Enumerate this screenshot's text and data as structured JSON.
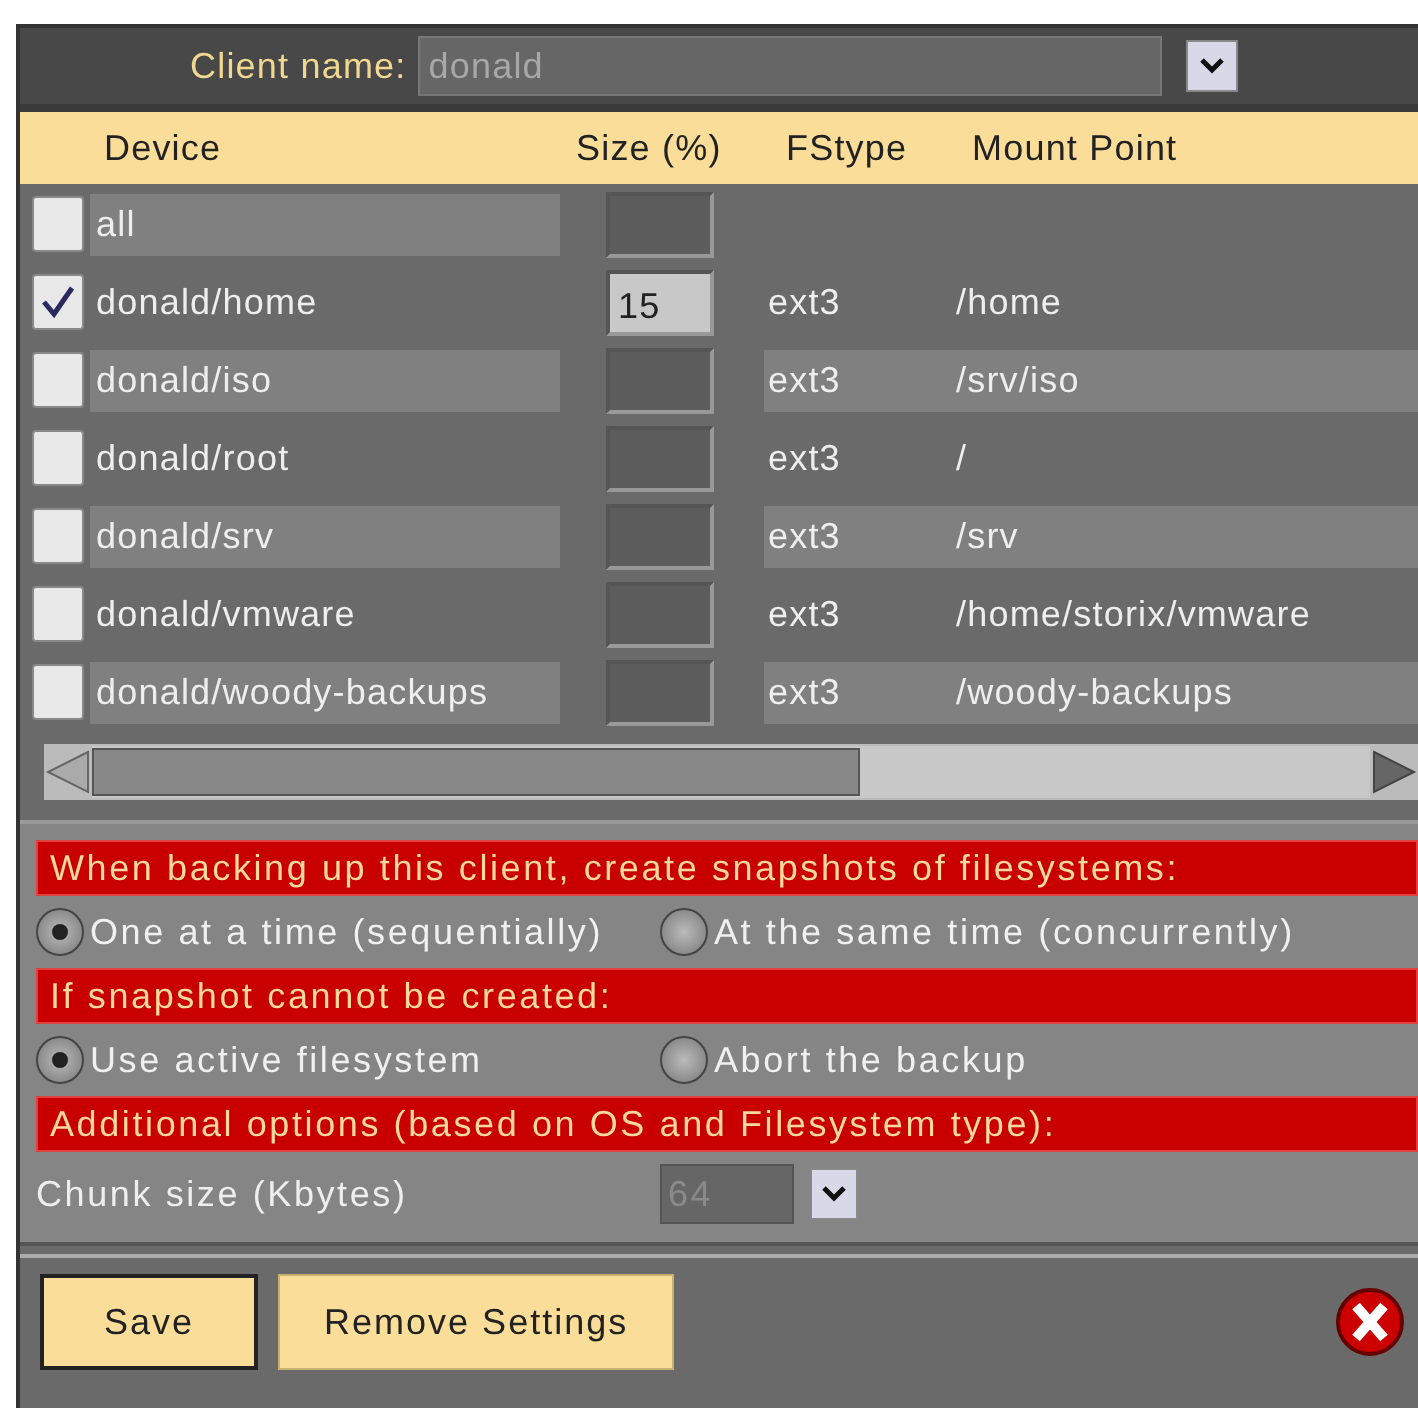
{
  "client": {
    "label": "Client name:",
    "value": "donald"
  },
  "table": {
    "columns": [
      "Device",
      "Size (%)",
      "FStype",
      "Mount Point"
    ],
    "rows": [
      {
        "checked": false,
        "device": "all"
      },
      {
        "checked": true,
        "device": "donald/home",
        "size": "15",
        "fstype": "ext3",
        "mount": "/home"
      },
      {
        "checked": false,
        "device": "donald/iso",
        "fstype": "ext3",
        "mount": "/srv/iso"
      },
      {
        "checked": false,
        "device": "donald/root",
        "fstype": "ext3",
        "mount": "/"
      },
      {
        "checked": false,
        "device": "donald/srv",
        "fstype": "ext3",
        "mount": "/srv"
      },
      {
        "checked": false,
        "device": "donald/vmware",
        "fstype": "ext3",
        "mount": "/home/storix/vmware"
      },
      {
        "checked": false,
        "device": "donald/woody-backups",
        "fstype": "ext3",
        "mount": "/woody-backups"
      }
    ]
  },
  "options": [
    {
      "kind": "heading",
      "text": "When backing up this client, create snapshots of filesystems:"
    },
    {
      "kind": "radios",
      "choices": [
        {
          "label": "One at a time (sequentially)",
          "selected": true
        },
        {
          "label": "At the same time (concurrently)",
          "selected": false
        }
      ]
    },
    {
      "kind": "heading",
      "text": "If snapshot cannot be created:"
    },
    {
      "kind": "radios",
      "choices": [
        {
          "label": "Use active filesystem",
          "selected": true
        },
        {
          "label": "Abort the backup",
          "selected": false
        }
      ]
    },
    {
      "kind": "heading",
      "text": "Additional options (based on OS and Filesystem type):"
    },
    {
      "kind": "select",
      "label": "Chunk size (Kbytes)",
      "value": "64"
    }
  ],
  "buttons": [
    {
      "label": "Save",
      "selected": true
    },
    {
      "label": "Remove Settings",
      "selected": false
    }
  ]
}
